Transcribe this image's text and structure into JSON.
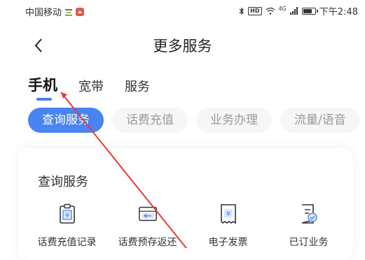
{
  "status_bar": {
    "carrier": "中国移动",
    "network": "4G",
    "hd": "HD",
    "time": "下午2:48",
    "battery_level": 0.8
  },
  "header": {
    "back_icon": "chevron-left-icon",
    "title": "更多服务"
  },
  "category_tabs": [
    {
      "label": "手机",
      "active": true
    },
    {
      "label": "宽带",
      "active": false
    },
    {
      "label": "服务",
      "active": false
    }
  ],
  "chips": [
    {
      "label": "查询服务",
      "active": true
    },
    {
      "label": "话费充值",
      "active": false
    },
    {
      "label": "业务办理",
      "active": false
    },
    {
      "label": "流量/语音",
      "active": false
    }
  ],
  "section": {
    "title": "查询服务",
    "items": [
      {
        "label": "话费充值记录",
        "icon": "recharge-record-icon"
      },
      {
        "label": "话费预存返还",
        "icon": "prepay-return-icon"
      },
      {
        "label": "电子发票",
        "icon": "e-invoice-icon"
      },
      {
        "label": "已订业务",
        "icon": "subscribed-services-icon"
      }
    ]
  },
  "colors": {
    "accent": "#4a84f2",
    "chip_bg": "#f5f6f8",
    "annotation": "#e53935"
  }
}
